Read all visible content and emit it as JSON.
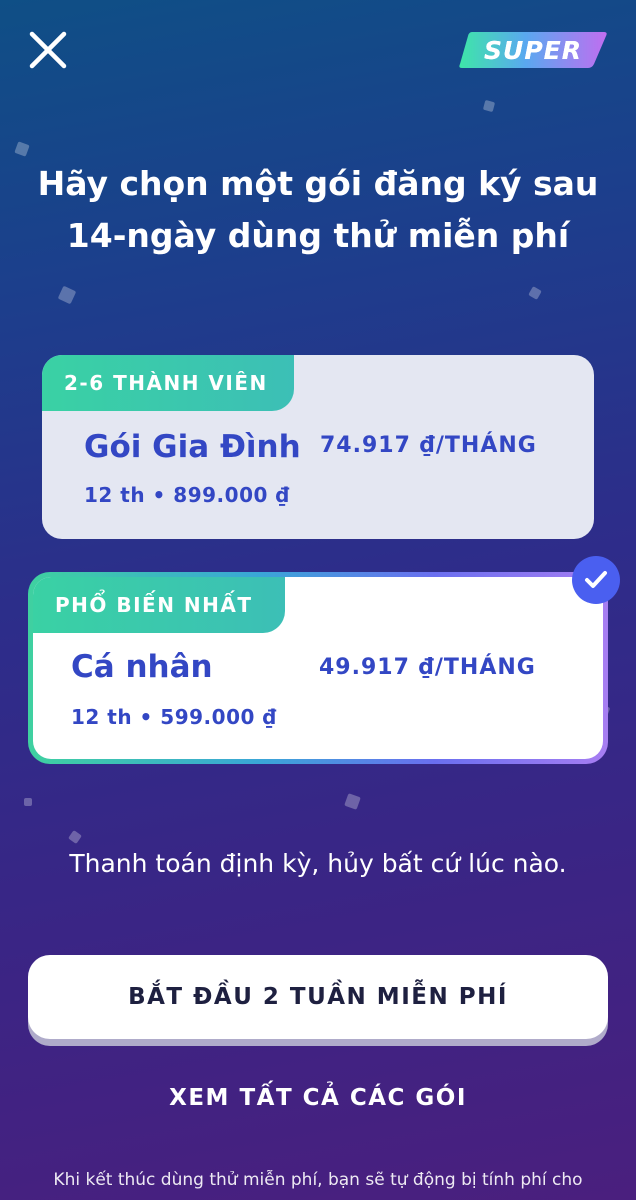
{
  "header": {
    "close_icon": "close-icon",
    "badge_text": "SUPER"
  },
  "headline": {
    "line1": "Hãy chọn một gói đăng ký sau",
    "line2": "14-ngày dùng thử miễn phí"
  },
  "plans": [
    {
      "tag": "2-6 THÀNH VIÊN",
      "name": "Gói Gia Đình",
      "price": "74.917 ₫/THÁNG",
      "total": "12 th • 899.000 ₫",
      "selected": false
    },
    {
      "tag": "PHỔ BIẾN NHẤT",
      "name": "Cá nhân",
      "price": "49.917 ₫/THÁNG",
      "total": "12 th • 599.000 ₫",
      "selected": true
    }
  ],
  "billing_note": "Thanh toán định kỳ, hủy bất cứ lúc nào.",
  "cta": {
    "start_label": "BẮT ĐẦU 2 TUẦN MIỄN PHÍ",
    "all_plans_label": "XEM TẤT CẢ CÁC GÓI"
  },
  "disclaimer": "Khi kết thúc dùng thử miễn phí, bạn sẽ tự động bị tính phí cho",
  "colors": {
    "plan_text": "#3347c4",
    "tag_green": "#3ad1a4",
    "check_blue": "#4a5ff0"
  }
}
